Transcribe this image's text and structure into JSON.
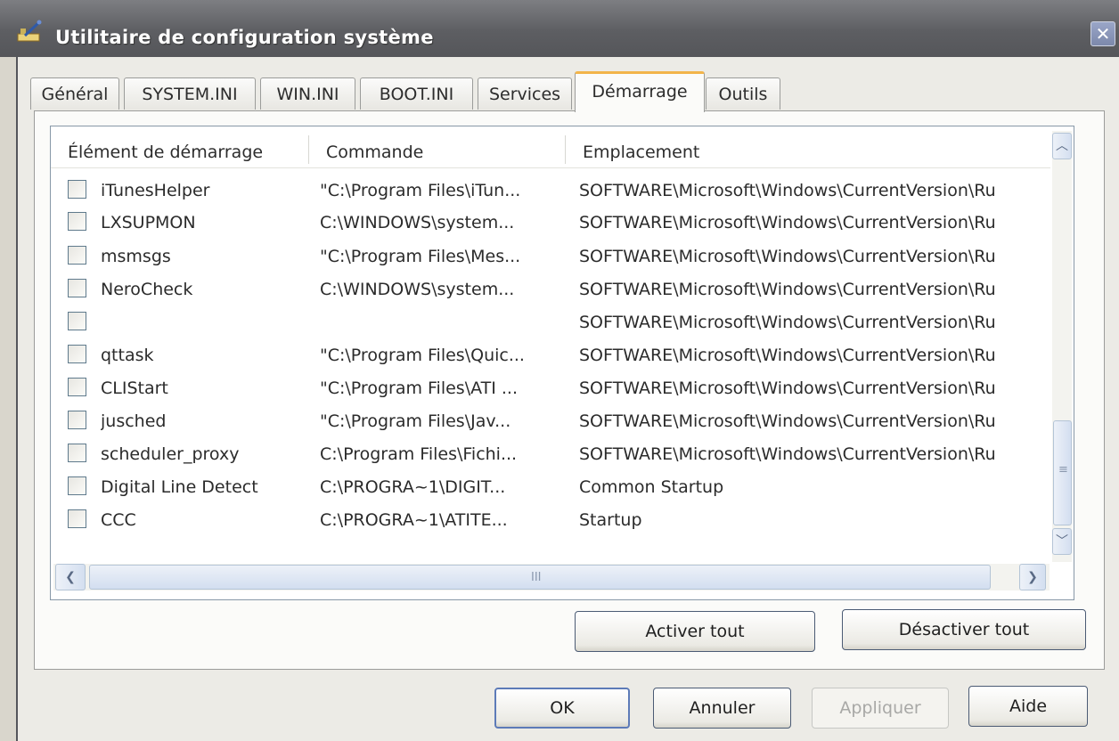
{
  "window": {
    "title": "Utilitaire de configuration système"
  },
  "tabs": [
    {
      "label": "Général",
      "active": false
    },
    {
      "label": "SYSTEM.INI",
      "active": false
    },
    {
      "label": "WIN.INI",
      "active": false
    },
    {
      "label": "BOOT.INI",
      "active": false
    },
    {
      "label": "Services",
      "active": false
    },
    {
      "label": "Démarrage",
      "active": true
    },
    {
      "label": "Outils",
      "active": false
    }
  ],
  "columns": [
    "Élément de démarrage",
    "Commande",
    "Emplacement"
  ],
  "rows": [
    {
      "name": "iTunesHelper",
      "command": "\"C:\\Program Files\\iTun...",
      "location": "SOFTWARE\\Microsoft\\Windows\\CurrentVersion\\Ru",
      "checked": false
    },
    {
      "name": "LXSUPMON",
      "command": "C:\\WINDOWS\\system...",
      "location": "SOFTWARE\\Microsoft\\Windows\\CurrentVersion\\Ru",
      "checked": false
    },
    {
      "name": "msmsgs",
      "command": "\"C:\\Program Files\\Mes...",
      "location": "SOFTWARE\\Microsoft\\Windows\\CurrentVersion\\Ru",
      "checked": false
    },
    {
      "name": "NeroCheck",
      "command": "C:\\WINDOWS\\system...",
      "location": "SOFTWARE\\Microsoft\\Windows\\CurrentVersion\\Ru",
      "checked": false
    },
    {
      "name": "",
      "command": "",
      "location": "SOFTWARE\\Microsoft\\Windows\\CurrentVersion\\Ru",
      "checked": false
    },
    {
      "name": "qttask",
      "command": "\"C:\\Program Files\\Quic...",
      "location": "SOFTWARE\\Microsoft\\Windows\\CurrentVersion\\Ru",
      "checked": false
    },
    {
      "name": "CLIStart",
      "command": "\"C:\\Program Files\\ATI ...",
      "location": "SOFTWARE\\Microsoft\\Windows\\CurrentVersion\\Ru",
      "checked": false
    },
    {
      "name": "jusched",
      "command": "\"C:\\Program Files\\Jav...",
      "location": "SOFTWARE\\Microsoft\\Windows\\CurrentVersion\\Ru",
      "checked": false
    },
    {
      "name": "scheduler_proxy",
      "command": "C:\\Program Files\\Fichi...",
      "location": "SOFTWARE\\Microsoft\\Windows\\CurrentVersion\\Ru",
      "checked": false
    },
    {
      "name": "Digital Line Detect",
      "command": "C:\\PROGRA~1\\DIGIT...",
      "location": "Common Startup",
      "checked": false
    },
    {
      "name": "CCC",
      "command": "C:\\PROGRA~1\\ATITE...",
      "location": "Startup",
      "checked": false
    }
  ],
  "buttons": {
    "enable_all": "Activer tout",
    "disable_all": "Désactiver tout",
    "ok": "OK",
    "cancel": "Annuler",
    "apply": "Appliquer",
    "help": "Aide"
  },
  "scrollbar": {
    "grip": "III",
    "grip_v": "≡"
  },
  "icons": {
    "title": "msconfig-icon",
    "close": "close-icon",
    "scroll_up": "chevron-up-icon",
    "scroll_down": "chevron-down-icon",
    "scroll_left": "chevron-left-icon",
    "scroll_right": "chevron-right-icon"
  }
}
